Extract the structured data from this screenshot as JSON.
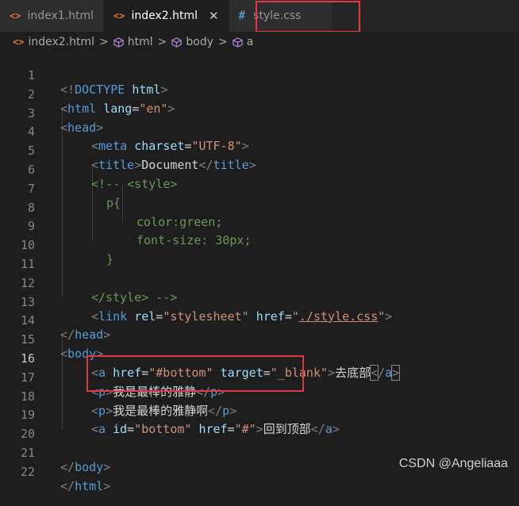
{
  "tabs": [
    {
      "label": "index1.html",
      "icon": "html-file-icon",
      "active": false
    },
    {
      "label": "index2.html",
      "icon": "html-file-icon",
      "active": true
    },
    {
      "label": "style.css",
      "icon": "css-file-icon",
      "active": false
    }
  ],
  "tab_close_glyph": "✕",
  "html_icon_glyph": "<>",
  "css_icon_glyph": "#",
  "breadcrumb": [
    "index2.html",
    "html",
    "body",
    "a"
  ],
  "breadcrumb_separator": ">",
  "line_numbers": [
    "1",
    "2",
    "3",
    "4",
    "5",
    "6",
    "7",
    "8",
    "9",
    "10",
    "11",
    "12",
    "13",
    "14",
    "15",
    "16",
    "17",
    "18",
    "19",
    "20",
    "21",
    "22"
  ],
  "current_line": "16",
  "code": {
    "l1": {
      "p1": "<!",
      "tag": "DOCTYPE",
      "sp": " ",
      "attr": "html",
      "p2": ">"
    },
    "l2": {
      "p1": "<",
      "tag": "html",
      "sp": " ",
      "attr": "lang",
      "eq": "=",
      "str": "\"en\"",
      "p2": ">"
    },
    "l3": {
      "p1": "<",
      "tag": "head",
      "p2": ">"
    },
    "l4": {
      "p1": "<",
      "tag": "meta",
      "sp": " ",
      "attr": "charset",
      "eq": "=",
      "str": "\"UTF-8\"",
      "p2": ">"
    },
    "l5": {
      "p1": "<",
      "tag": "title",
      "p2": ">",
      "text": "Document",
      "p3": "</",
      "tag2": "title",
      "p4": ">"
    },
    "l6": "<!-- <style>",
    "l7": "p{",
    "l8": "color:green;",
    "l9": "font-size: 30px;",
    "l10": "}",
    "l12": "</style> -->",
    "l13": {
      "p1": "<",
      "tag": "link",
      "sp": " ",
      "attr": "rel",
      "eq": "=",
      "str": "\"stylesheet\"",
      "sp2": " ",
      "attr2": "href",
      "eq2": "=",
      "q1": "\"",
      "str2": "./style.css",
      "q2": "\"",
      "p2": ">"
    },
    "l14": {
      "p1": "</",
      "tag": "head",
      "p2": ">"
    },
    "l15": {
      "p1": "<",
      "tag": "body",
      "p2": ">"
    },
    "l16": {
      "p1": "<",
      "tag": "a",
      "sp": " ",
      "attr": "href",
      "eq": "=",
      "str": "\"#bottom\"",
      "sp2": " ",
      "attr2": "target",
      "eq2": "=",
      "str2": "\"_blank\"",
      "p2": ">",
      "text": "去底部",
      "p3": "<",
      "p3b": "/",
      "tag2": "a",
      "p4": ">"
    },
    "l17": {
      "p1": "<",
      "tag": "p",
      "p2": ">",
      "text": "我是最棒的雅静",
      "p3": "</",
      "tag2": "p",
      "p4": ">"
    },
    "l18": {
      "p1": "<",
      "tag": "p",
      "p2": ">",
      "text": "我是最棒的雅静啊",
      "p3": "</",
      "tag2": "p",
      "p4": ">"
    },
    "l19": {
      "p1": "<",
      "tag": "a",
      "sp": " ",
      "attr": "id",
      "eq": "=",
      "str": "\"bottom\"",
      "sp2": " ",
      "attr2": "href",
      "eq2": "=",
      "str2": "\"#\"",
      "p2": ">",
      "text": "回到顶部",
      "p3": "</",
      "tag2": "a",
      "p4": ">"
    },
    "l21": {
      "p1": "</",
      "tag": "body",
      "p2": ">"
    },
    "l22": {
      "p1": "</",
      "tag": "html",
      "p2": ">"
    }
  },
  "watermark": "CSDN @Angeliaaa",
  "colors": {
    "background": "#1e1e1e",
    "tag": "#569cd6",
    "attribute": "#9cdcfe",
    "string": "#ce9178",
    "comment": "#6a9955",
    "punctuation": "#808080",
    "highlight_box": "#e03a3e",
    "html_icon": "#e37933",
    "css_icon": "#519aba"
  }
}
